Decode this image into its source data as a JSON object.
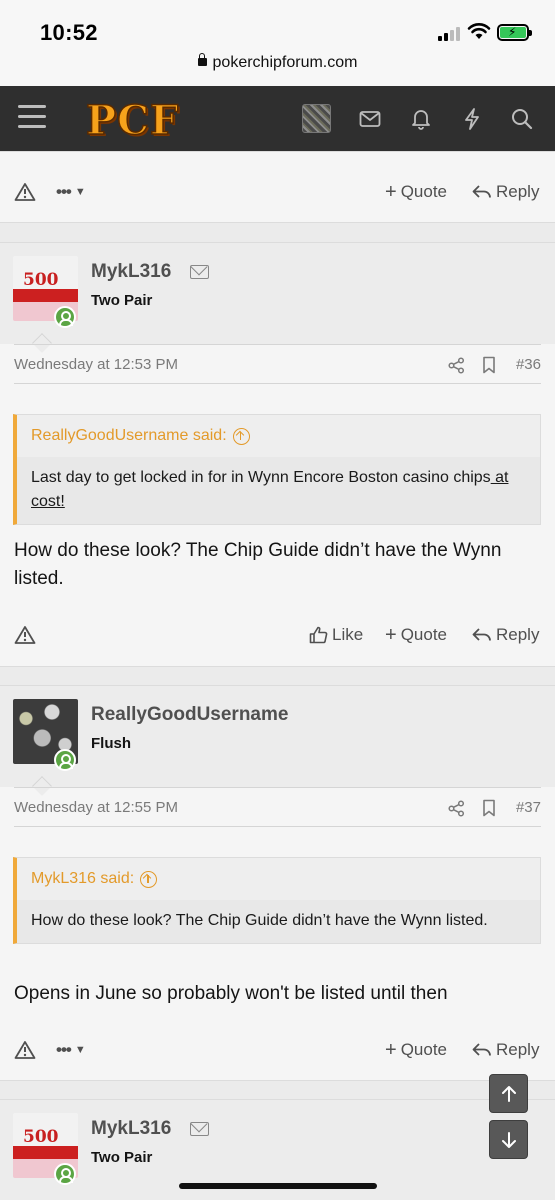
{
  "status": {
    "time": "10:52",
    "url": "pokerchipforum.com"
  },
  "header": {
    "logo": "PCF"
  },
  "actions": {
    "quote": "Quote",
    "reply": "Reply",
    "like": "Like",
    "more": "•••"
  },
  "posts": [
    {
      "username": "MykL316",
      "user_title": "Two Pair",
      "date": "Wednesday at 12:53 PM",
      "number": "#36",
      "quote_author": "ReallyGoodUsername said:",
      "quote_text": "Last day to get locked in for in Wynn Encore Boston casino chips",
      "quote_link": " at cost!",
      "message": "How do these look? The Chip Guide didn’t have the Wynn listed."
    },
    {
      "username": "ReallyGoodUsername",
      "user_title": "Flush",
      "date": "Wednesday at 12:55 PM",
      "number": "#37",
      "quote_author": "MykL316 said:",
      "quote_text": "How do these look? The Chip Guide didn’t have the Wynn listed.",
      "message": "Opens in June so probably won't be listed until then"
    },
    {
      "username": "MykL316",
      "user_title": "Two Pair"
    }
  ]
}
